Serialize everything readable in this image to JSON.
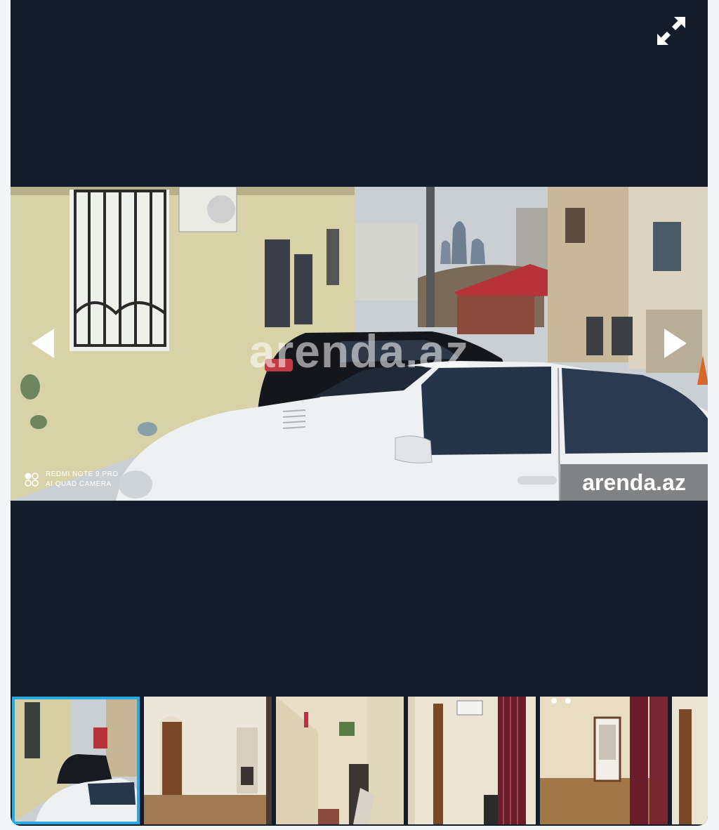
{
  "gallery": {
    "fullscreen_icon": "expand-arrows-icon",
    "prev_icon": "chevron-left-icon",
    "next_icon": "chevron-right-icon",
    "watermark_center": "arenda.az",
    "watermark_badge": "arenda.az",
    "camera_line1": "REDMI NOTE 9 PRO",
    "camera_line2": "AI QUAD CAMERA",
    "active_thumbnail": 1,
    "thumbnail_count": 6
  }
}
